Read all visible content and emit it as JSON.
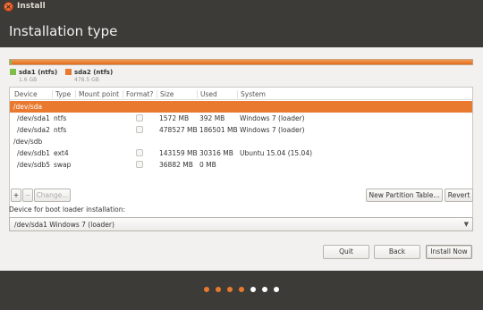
{
  "window": {
    "title": "Install",
    "close_glyph": "×"
  },
  "page": {
    "title": "Installation type"
  },
  "legend": [
    {
      "name": "sda1 (ntfs)",
      "size": "1.6 GB",
      "color": "#7ebe4a"
    },
    {
      "name": "sda2 (ntfs)",
      "size": "478.5 GB",
      "color": "#e9792f"
    }
  ],
  "table": {
    "headers": [
      "Device",
      "Type",
      "Mount point",
      "Format?",
      "Size",
      "Used",
      "System"
    ],
    "rows": [
      {
        "device": "/dev/sda",
        "type": "",
        "mount": "",
        "format": false,
        "size": "",
        "used": "",
        "system": "",
        "selected": true,
        "group": true
      },
      {
        "device": "/dev/sda1",
        "type": "ntfs",
        "mount": "",
        "format": false,
        "size": "1572 MB",
        "used": "392 MB",
        "system": "Windows 7 (loader)"
      },
      {
        "device": "/dev/sda2",
        "type": "ntfs",
        "mount": "",
        "format": false,
        "size": "478527 MB",
        "used": "186501 MB",
        "system": "Windows 7 (loader)"
      },
      {
        "device": "/dev/sdb",
        "type": "",
        "mount": "",
        "format": false,
        "size": "",
        "used": "",
        "system": "",
        "group": true
      },
      {
        "device": "/dev/sdb1",
        "type": "ext4",
        "mount": "",
        "format": false,
        "size": "143159 MB",
        "used": "30316 MB",
        "system": "Ubuntu 15.04 (15.04)"
      },
      {
        "device": "/dev/sdb5",
        "type": "swap",
        "mount": "",
        "format": false,
        "size": "36882 MB",
        "used": "0 MB",
        "system": ""
      }
    ]
  },
  "toolbar": {
    "add_label": "+",
    "remove_label": "−",
    "change_label": "Change...",
    "new_table_label": "New Partition Table...",
    "revert_label": "Revert"
  },
  "bootloader": {
    "label": "Device for boot loader installation:",
    "value": "/dev/sda1   Windows 7 (loader)",
    "arrow": "▼"
  },
  "actions": {
    "quit": "Quit",
    "back": "Back",
    "install": "Install Now"
  },
  "progress": {
    "total_steps": 7,
    "current_step": 4,
    "done_color": "#e9792f",
    "todo_color": "#ffffff"
  }
}
